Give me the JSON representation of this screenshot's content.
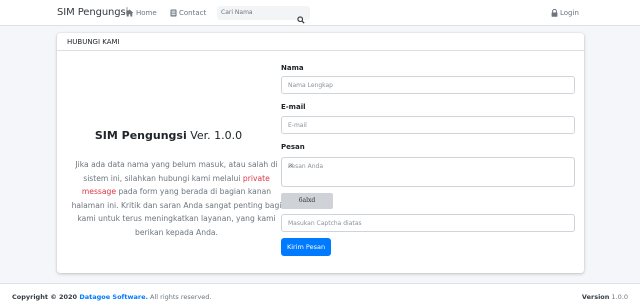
{
  "navbar": {
    "brand": "SIM Pengungsi",
    "home_label": "Home",
    "contact_label": "Contact",
    "search_placeholder": "Cari Nama",
    "login_label": "Login"
  },
  "card": {
    "title": "HUBUNGI KAMI",
    "heading_brand": "SIM Pengungsi",
    "heading_version": " Ver. 1.0.0",
    "desc_before": "Jika ada data nama yang belum masuk, atau salah di sistem ini, silahkan hubungi kami melalui ",
    "desc_link": "private message",
    "desc_after": " pada form yang berada di bagian kanan halaman ini. Kritik dan saran Anda sangat penting bagi kami untuk terus meningkatkan layanan, yang kami berikan kepada Anda."
  },
  "form": {
    "name_label": "Nama",
    "name_placeholder": "Nama Lengkap",
    "email_label": "E-mail",
    "email_placeholder": "E-mail",
    "message_label": "Pesan",
    "message_placeholder": "Pesan Anda",
    "captcha_text": "6alxd",
    "captcha_placeholder": "Masukan Captcha diatas",
    "submit_label": "Kirim Pesan"
  },
  "footer": {
    "copyright_prefix": "Copyright © 2020 ",
    "company": "Datagoe Software.",
    "rights": " All rights reserved.",
    "version_label": "Version",
    "version_value": " 1.0.0"
  },
  "colors": {
    "primary": "#007bff",
    "link_red": "#dc3545",
    "background": "#f4f6f9"
  }
}
